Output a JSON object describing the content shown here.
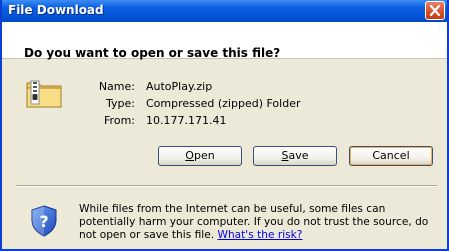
{
  "window": {
    "title": "File Download"
  },
  "header": {
    "question": "Do you want to open or save this file?"
  },
  "file": {
    "icon": "zip-folder-icon",
    "name_label": "Name:",
    "name_value": "AutoPlay.zip",
    "type_label": "Type:",
    "type_value": "Compressed (zipped) Folder",
    "from_label": "From:",
    "from_value": "10.177.171.41"
  },
  "buttons": {
    "open": {
      "accel": "O",
      "rest": "pen"
    },
    "save": {
      "accel": "S",
      "rest": "ave"
    },
    "cancel": "Cancel"
  },
  "warning": {
    "icon": "shield-question-icon",
    "text": "While files from the Internet can be useful, some files can potentially harm your computer. If you do not trust the source, do not open or save this file. ",
    "link": "What's the risk?"
  },
  "colors": {
    "titlebar": "#0555d8",
    "dialog_bg": "#ece9d8",
    "close_button": "#d9532b",
    "link": "#0000ee"
  }
}
